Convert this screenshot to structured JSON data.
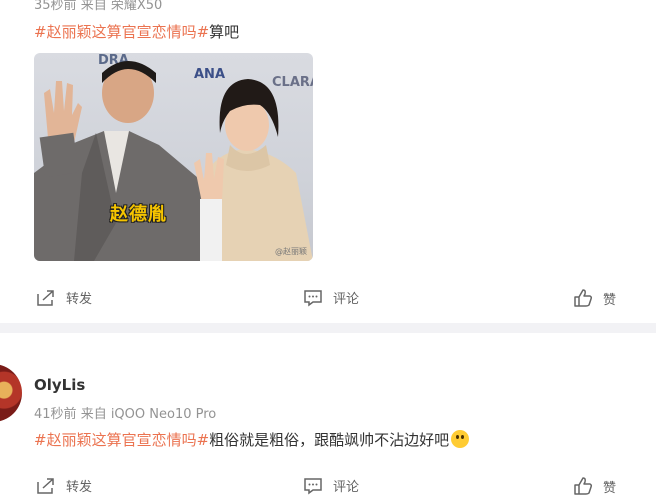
{
  "post1": {
    "time": "35秒前",
    "source": "来自 荣耀X50",
    "hashtag": "#赵丽颖这算官宣恋情吗#",
    "text": "算吧",
    "image": {
      "logos": [
        "DRA",
        "ANA",
        "CLARA"
      ],
      "caption": "赵德胤",
      "watermark": "@赵丽颖"
    },
    "actions": {
      "repost": "转发",
      "comment": "评论",
      "like": "赞"
    }
  },
  "post2": {
    "username": "OlyLis",
    "time": "41秒前",
    "source": "来自 iQOO Neo10 Pro",
    "hashtag": "#赵丽颖这算官宣恋情吗#",
    "text": "粗俗就是粗俗，跟酷飒帅不沾边好吧",
    "actions": {
      "repost": "转发",
      "comment": "评论",
      "like": "赞"
    }
  },
  "colors": {
    "hashtag": "#eb7350",
    "meta": "#939393",
    "divider": "#f2f2f5"
  }
}
